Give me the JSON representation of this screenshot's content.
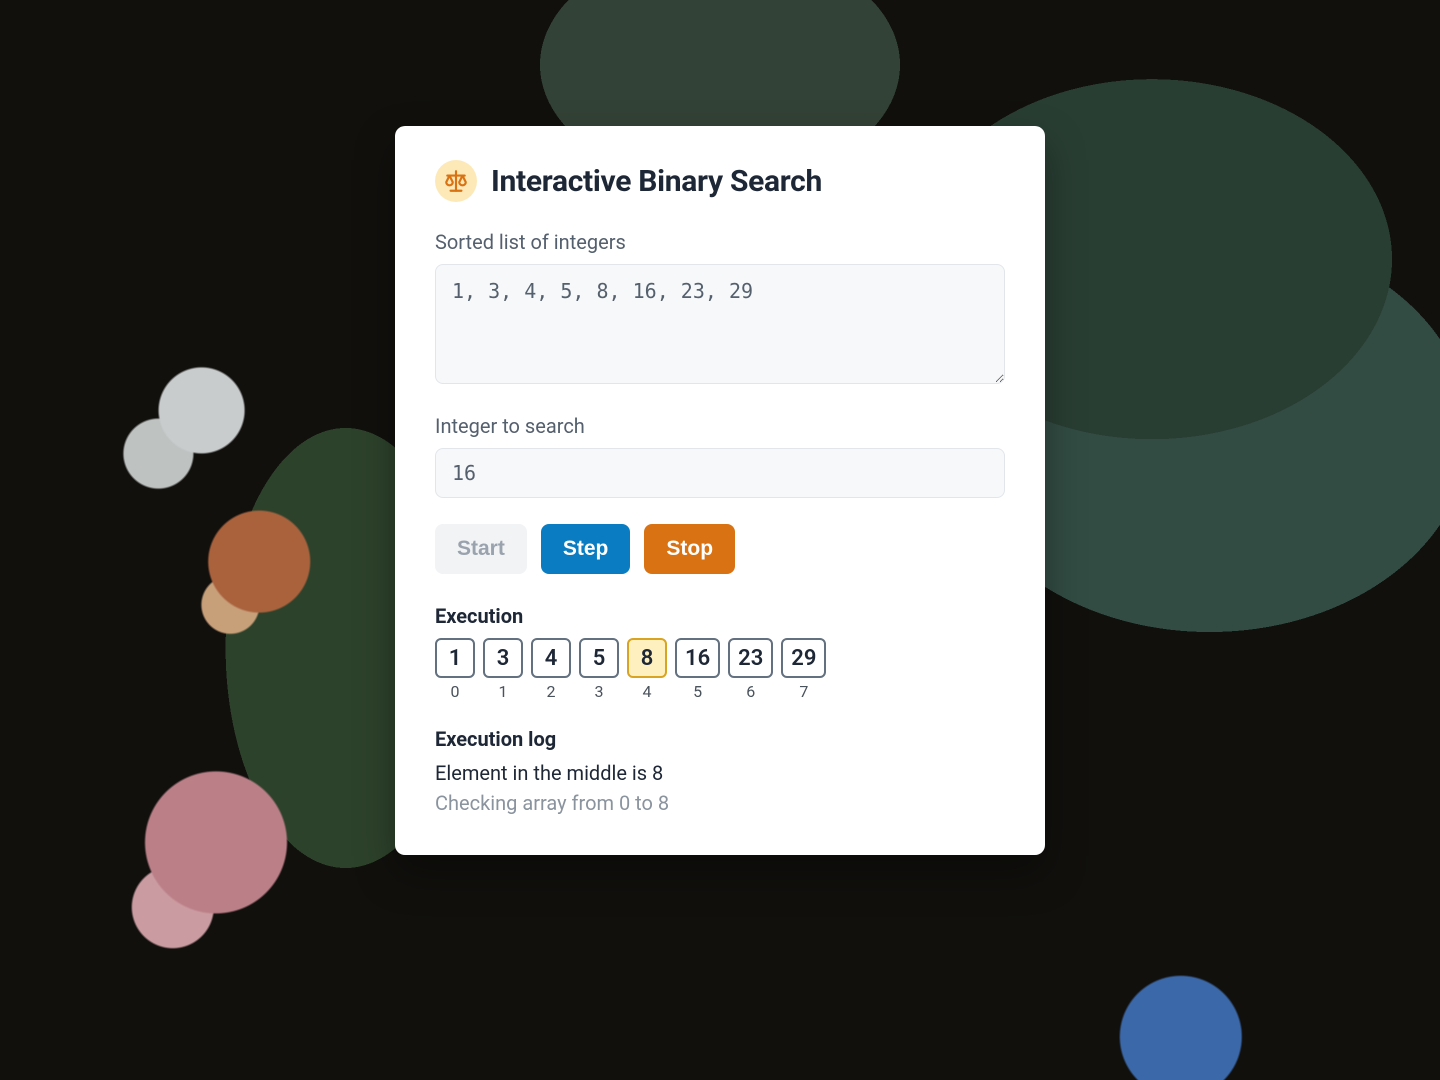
{
  "header": {
    "title": "Interactive Binary Search",
    "icon_name": "scales-icon"
  },
  "inputs": {
    "list_label": "Sorted list of integers",
    "list_value": "1, 3, 4, 5, 8, 16, 23, 29",
    "search_label": "Integer to search",
    "search_value": "16"
  },
  "buttons": {
    "start_label": "Start",
    "step_label": "Step",
    "stop_label": "Stop"
  },
  "execution": {
    "heading": "Execution",
    "cells": [
      {
        "value": "1",
        "index": "0",
        "state": "range"
      },
      {
        "value": "3",
        "index": "1",
        "state": "range"
      },
      {
        "value": "4",
        "index": "2",
        "state": "range"
      },
      {
        "value": "5",
        "index": "3",
        "state": "range"
      },
      {
        "value": "8",
        "index": "4",
        "state": "mid"
      },
      {
        "value": "16",
        "index": "5",
        "state": "range"
      },
      {
        "value": "23",
        "index": "6",
        "state": "range"
      },
      {
        "value": "29",
        "index": "7",
        "state": "range"
      }
    ]
  },
  "log": {
    "heading": "Execution log",
    "lines": [
      {
        "text": "Element in the middle is 8",
        "dim": false
      },
      {
        "text": "Checking array from 0 to 8",
        "dim": true
      }
    ]
  }
}
